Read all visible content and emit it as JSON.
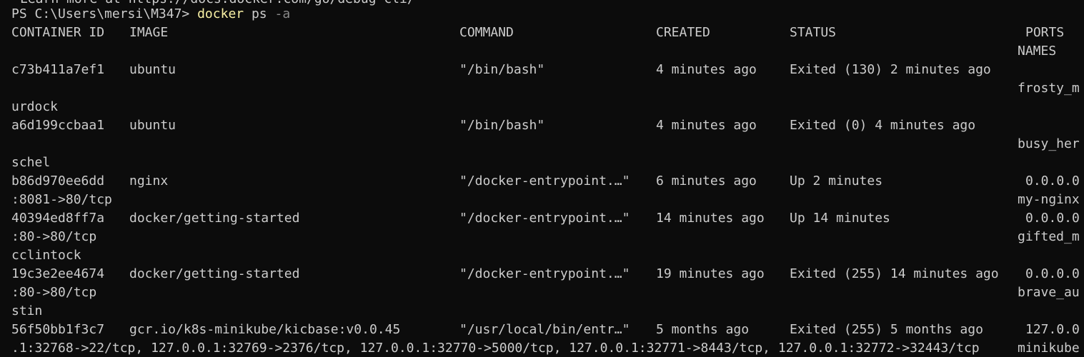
{
  "terminal": {
    "top_partial": "Learn more at https://docs.docker.com/go/debug-cli/",
    "prompt": "PS C:\\Users\\mersi\\M347>",
    "command": {
      "program": "docker",
      "args": "ps",
      "flag": "-a"
    },
    "headers": {
      "container_id": "CONTAINER ID",
      "image": "IMAGE",
      "command": "COMMAND",
      "created": "CREATED",
      "status": "STATUS",
      "ports": "PORTS",
      "names": "NAMES"
    },
    "rows": [
      {
        "container_id": "c73b411a7ef1",
        "image": "ubuntu",
        "command": "\"/bin/bash\"",
        "created": "4 minutes ago",
        "status": "Exited (130) 2 minutes ago",
        "names_start": "frosty_m",
        "names_end": "urdock"
      },
      {
        "container_id": "a6d199ccbaa1",
        "image": "ubuntu",
        "command": "\"/bin/bash\"",
        "created": "4 minutes ago",
        "status": "Exited (0) 4 minutes ago",
        "names_start": "busy_her",
        "names_end": "schel"
      },
      {
        "container_id": "b86d970ee6dd",
        "image": "nginx",
        "command": "\"/docker-entrypoint.…\"",
        "created": "6 minutes ago",
        "status": "Up 2 minutes",
        "ports_start": "0.0.0.0",
        "ports_end": ":8081->80/tcp",
        "names": "my-nginx"
      },
      {
        "container_id": "40394ed8ff7a",
        "image": "docker/getting-started",
        "command": "\"/docker-entrypoint.…\"",
        "created": "14 minutes ago",
        "status": "Up 14 minutes",
        "ports_start": "0.0.0.0",
        "ports_end": ":80->80/tcp",
        "names_start": "gifted_m",
        "names_end": "cclintock"
      },
      {
        "container_id": "19c3e2ee4674",
        "image": "docker/getting-started",
        "command": "\"/docker-entrypoint.…\"",
        "created": "19 minutes ago",
        "status": "Exited (255) 14 minutes ago",
        "ports_start": "0.0.0.0",
        "ports_end": ":80->80/tcp",
        "names_start": "brave_au",
        "names_end": "stin"
      },
      {
        "container_id": "56f50bb1f3c7",
        "image": "gcr.io/k8s-minikube/kicbase:v0.0.45",
        "command": "\"/usr/local/bin/entr…\"",
        "created": "5 months ago",
        "status": "Exited (255) 5 months ago",
        "ports_start": "127.0.0",
        "ports_end": ".1:32768->22/tcp, 127.0.0.1:32769->2376/tcp, 127.0.0.1:32770->5000/tcp, 127.0.0.1:32771->8443/tcp, 127.0.0.1:32772->32443/tcp",
        "names": "minikube"
      }
    ]
  },
  "colors": {
    "background": "#0c0c0c",
    "text": "#cccccc",
    "command_program": "#f9f1a5",
    "command_flag": "#8a8a8a"
  }
}
